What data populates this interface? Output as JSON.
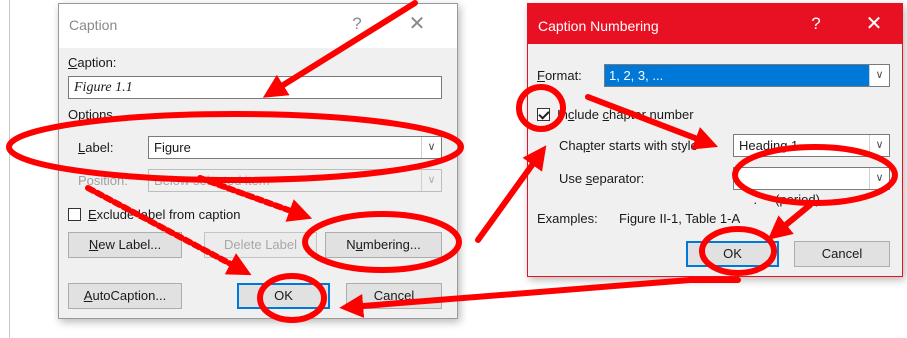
{
  "caption_dialog": {
    "title": "Caption",
    "help_glyph": "?",
    "close_glyph": "✕",
    "caption_label": "aption:",
    "caption_label_key": "C",
    "caption_value": "Figure 1.1",
    "options_label": "Options",
    "label_label": "abel:",
    "label_label_key": "L",
    "label_value": "Figure",
    "position_label": "Position:",
    "position_value": "Below selected item",
    "exclude_label": "label from caption",
    "exclude_key": "E",
    "exclude_label_prefix": "xclude ",
    "exclude_checked": false,
    "new_label_button_key": "N",
    "new_label_button": "ew Label...",
    "delete_label_button": "Delete Label",
    "numbering_button_prefix": "N",
    "numbering_button_key": "u",
    "numbering_button_suffix": "mbering...",
    "autocaption_button_key": "A",
    "autocaption_button": "utoCaption...",
    "ok_button": "OK",
    "cancel_button": "Cancel"
  },
  "numbering_dialog": {
    "title": "Caption Numbering",
    "help_glyph": "?",
    "close_glyph": "✕",
    "format_label_key": "F",
    "format_label": "ormat:",
    "format_value": "1, 2, 3, ...",
    "include_chapter_prefix": "In",
    "include_chapter_key": "c",
    "include_chapter_suffix": "lude ",
    "include_chapter_key2": "c",
    "include_chapter_rest": "hapter number",
    "include_chapter_checked": true,
    "chapter_style_label_prefix": "Cha",
    "chapter_style_label_key": "p",
    "chapter_style_label_suffix": "ter starts with style",
    "chapter_style_value": "Heading 1",
    "separator_label_prefix": "Use ",
    "separator_label_key": "s",
    "separator_label_suffix": "eparator:",
    "separator_value": ".     (period)",
    "examples_label": "Examples:",
    "examples_value": "Figure II-1, Table 1-A",
    "ok_button": "OK",
    "cancel_button": "Cancel"
  },
  "colors": {
    "annotation_red": "#ff0000",
    "accent_blue": "#0078d7",
    "titlebar_red": "#e81123"
  }
}
